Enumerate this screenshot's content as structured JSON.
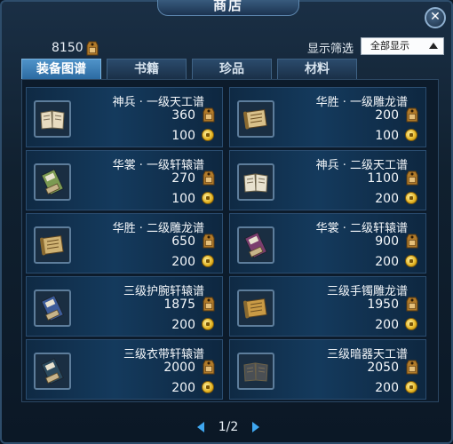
{
  "window": {
    "title": "商店",
    "close_label": "✕"
  },
  "currency": {
    "amount": "8150",
    "icon": "token-tag-icon"
  },
  "filter": {
    "label": "显示筛选",
    "selected": "全部显示"
  },
  "tabs": [
    {
      "label": "装备图谱",
      "active": true
    },
    {
      "label": "书籍",
      "active": false
    },
    {
      "label": "珍品",
      "active": false
    },
    {
      "label": "材料",
      "active": false
    }
  ],
  "items": [
    {
      "name": "神兵 · 一级天工谱",
      "price": "360",
      "coin": "100",
      "icon": "open-book-icon",
      "color": "#e8dcc0"
    },
    {
      "name": "华胜 · 一级雕龙谱",
      "price": "200",
      "coin": "100",
      "icon": "scroll-icon",
      "color": "#d8c08a"
    },
    {
      "name": "华裳 · 一级轩辕谱",
      "price": "270",
      "coin": "100",
      "icon": "green-book-icon",
      "color": "#7c9a52"
    },
    {
      "name": "神兵 · 二级天工谱",
      "price": "1100",
      "coin": "200",
      "icon": "open-book-icon",
      "color": "#e8e2cf"
    },
    {
      "name": "华胜 · 二级雕龙谱",
      "price": "650",
      "coin": "200",
      "icon": "map-scroll-icon",
      "color": "#cfb273"
    },
    {
      "name": "华裳 · 二级轩辕谱",
      "price": "900",
      "coin": "200",
      "icon": "purple-book-icon",
      "color": "#7b3d6e"
    },
    {
      "name": "三级护腕轩辕谱",
      "price": "1875",
      "coin": "200",
      "icon": "blue-book-icon",
      "color": "#3d5c9a"
    },
    {
      "name": "三级手镯雕龙谱",
      "price": "1950",
      "coin": "200",
      "icon": "scroll-icon",
      "color": "#c99a45"
    },
    {
      "name": "三级衣带轩辕谱",
      "price": "2000",
      "coin": "200",
      "icon": "dark-book-icon",
      "color": "#2b4a5e"
    },
    {
      "name": "三级暗器天工谱",
      "price": "2050",
      "coin": "200",
      "icon": "dark-open-book-icon",
      "color": "#4a4f54"
    }
  ],
  "pager": {
    "text": "1/2"
  },
  "colors": {
    "tab_active": "#3d86c2",
    "item_bg": "#143a5d",
    "coin": "#e3b320",
    "pager_arrow": "#3fa7f0"
  }
}
